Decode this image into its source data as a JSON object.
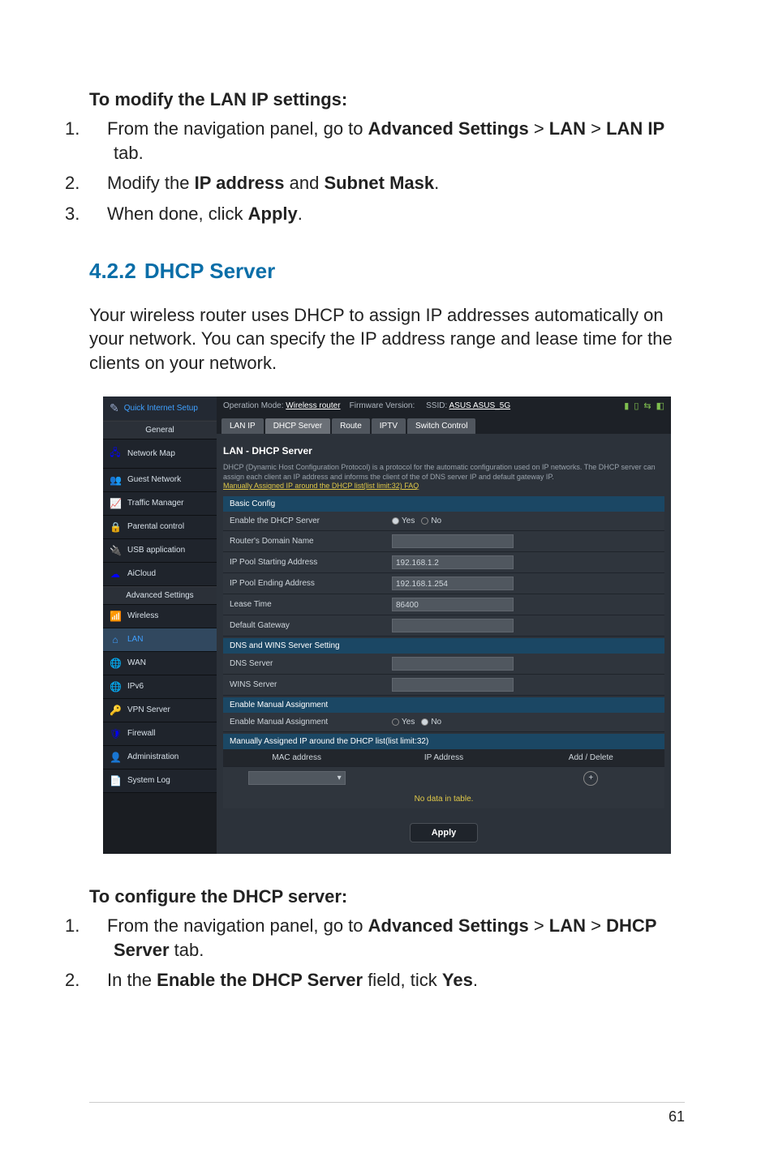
{
  "section_lanip": {
    "heading": "To modify the LAN IP settings:",
    "steps": [
      {
        "num": "1.",
        "pre": "From the navigation panel, go to ",
        "b1": "Advanced Settings",
        "mid1": " > ",
        "b2": "LAN",
        "mid2": " > ",
        "b3": "LAN IP",
        "post": " tab."
      },
      {
        "num": "2.",
        "pre": "Modify the ",
        "b1": "IP address",
        "mid1": " and ",
        "b2": "Subnet Mask",
        "post": "."
      },
      {
        "num": "3.",
        "pre": "When done, click ",
        "b1": "Apply",
        "post": "."
      }
    ]
  },
  "section_title": {
    "num": "4.2.2",
    "text": "DHCP Server"
  },
  "intro": "Your wireless router uses DHCP to assign IP addresses automatically on your network. You can specify the IP address range and lease time for the clients on your network.",
  "screenshot": {
    "qis": "Quick Internet Setup",
    "general": "General",
    "general_items": [
      {
        "icon": "🖧",
        "label": "Network Map",
        "color": "blue"
      },
      {
        "icon": "👥",
        "label": "Guest Network",
        "color": "#d48"
      },
      {
        "icon": "📈",
        "label": "Traffic Manager",
        "color": "#7c4"
      },
      {
        "icon": "🔒",
        "label": "Parental control",
        "color": "#fb0"
      },
      {
        "icon": "🔌",
        "label": "USB application",
        "color": "blue"
      },
      {
        "icon": "☁",
        "label": "AiCloud",
        "color": "blue"
      }
    ],
    "advanced": "Advanced Settings",
    "advanced_items": [
      {
        "icon": "📶",
        "label": "Wireless",
        "color": "blue"
      },
      {
        "icon": "⌂",
        "label": "LAN",
        "active": true,
        "color": "#3fa0ff"
      },
      {
        "icon": "🌐",
        "label": "WAN",
        "color": "blue"
      },
      {
        "icon": "🌐",
        "label": "IPv6",
        "color": "#6cf"
      },
      {
        "icon": "🔑",
        "label": "VPN Server",
        "color": "#d44"
      },
      {
        "icon": "🛡",
        "label": "Firewall",
        "color": "blue"
      },
      {
        "icon": "👤",
        "label": "Administration",
        "color": "#d86"
      },
      {
        "icon": "📄",
        "label": "System Log",
        "color": "#6cf"
      }
    ],
    "topbar": {
      "mode_label": "Operation Mode:",
      "mode": "Wireless router",
      "fw_label": "Firmware Version:",
      "ssid_label": "SSID:",
      "ssid": "ASUS  ASUS_5G"
    },
    "tabs": [
      "LAN IP",
      "DHCP Server",
      "Route",
      "IPTV",
      "Switch Control"
    ],
    "panel_title": "LAN - DHCP Server",
    "desc": "DHCP (Dynamic Host Configuration Protocol) is a protocol for the automatic configuration used on IP networks. The DHCP server can assign each client an IP address and informs the client of the of DNS server IP and default gateway IP.",
    "desc_link": "Manually Assigned IP around the DHCP list(list limit:32) FAQ",
    "sections": {
      "basic": {
        "head": "Basic Config",
        "rows": [
          {
            "label": "Enable the DHCP Server",
            "type": "radio",
            "opt1": "Yes",
            "opt2": "No",
            "sel": 1
          },
          {
            "label": "Router's Domain Name",
            "type": "input",
            "value": ""
          },
          {
            "label": "IP Pool Starting Address",
            "type": "input",
            "value": "192.168.1.2"
          },
          {
            "label": "IP Pool Ending Address",
            "type": "input",
            "value": "192.168.1.254"
          },
          {
            "label": "Lease Time",
            "type": "input",
            "value": "86400"
          },
          {
            "label": "Default Gateway",
            "type": "input",
            "value": ""
          }
        ]
      },
      "dns": {
        "head": "DNS and WINS Server Setting",
        "rows": [
          {
            "label": "DNS Server",
            "type": "input",
            "value": ""
          },
          {
            "label": "WINS Server",
            "type": "input",
            "value": ""
          }
        ]
      },
      "manual": {
        "head": "Enable Manual Assignment",
        "rows": [
          {
            "label": "Enable Manual Assignment",
            "type": "radio",
            "opt1": "Yes",
            "opt2": "No",
            "sel": 2
          }
        ]
      },
      "table": {
        "head": "Manually Assigned IP around the DHCP list(list limit:32)",
        "cols": [
          "MAC address",
          "IP Address",
          "Add / Delete"
        ],
        "nodata": "No data in table."
      }
    },
    "apply": "Apply"
  },
  "section_configure": {
    "heading": "To configure the DHCP server:",
    "steps": [
      {
        "num": "1.",
        "pre": "From the navigation panel, go to ",
        "b1": "Advanced Settings",
        "mid1": " > ",
        "b2": "LAN",
        "mid2": " > ",
        "b3": "DHCP Server",
        "post": " tab."
      },
      {
        "num": "2.",
        "pre": "In the ",
        "b1": "Enable the DHCP Server",
        "mid1": " field, tick ",
        "b2": "Yes",
        "post": "."
      }
    ]
  },
  "page_number": "61"
}
